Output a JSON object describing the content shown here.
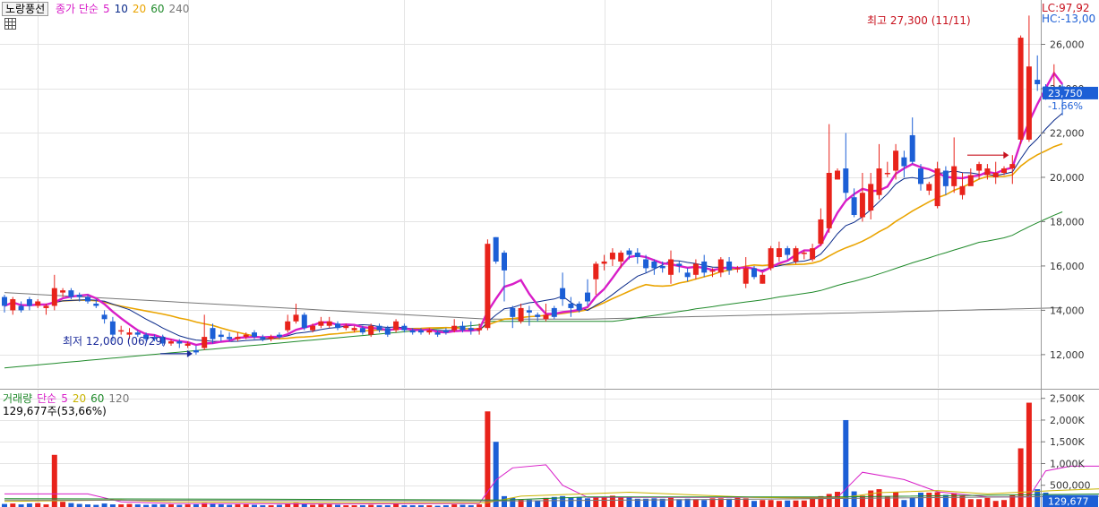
{
  "header": {
    "stock_name": "노랑풍선",
    "price_legend": [
      "종가 단순",
      "5",
      "10",
      "20",
      "60",
      "240"
    ],
    "volume_legend": [
      "거래량",
      "단순",
      "5",
      "20",
      "60",
      "120"
    ],
    "volume_info": "129,677주(53,66%)",
    "lc": "LC:97,92",
    "hc": "HC:-13,00"
  },
  "annotations": {
    "high": "최고 27,300 (11/11)",
    "low": "최저 12,000 (06/29)"
  },
  "price_axis": {
    "ticks": [
      "12,000",
      "14,000",
      "16,000",
      "18,000",
      "20,000",
      "22,000",
      "24,000",
      "26,000"
    ],
    "current": "23,750",
    "change": "-1.66%"
  },
  "volume_axis": {
    "ticks": [
      "500,000",
      "1,000K",
      "1,500K",
      "2,000K",
      "2,500K"
    ],
    "current": "129,677",
    "pct": "53,66%"
  },
  "colors": {
    "up": "#e8231b",
    "down": "#1c5fd6",
    "ma5": "#d81ec8",
    "ma10": "#0a2a8a",
    "ma20": "#eaa400",
    "ma60": "#1f8a2a",
    "ma240": "#777777",
    "vma5": "#d81ec8",
    "vma20": "#c8b400",
    "vma60": "#1f8a2a",
    "vma120": "#777777"
  },
  "chart_data": {
    "type": "candlestick",
    "price_ylim": [
      10500,
      28000
    ],
    "volume_ylim": [
      0,
      2700000
    ],
    "candles": [
      [
        14600,
        14200,
        14700,
        13900
      ],
      [
        14000,
        14500,
        14600,
        13800
      ],
      [
        14200,
        14000,
        14400,
        13900
      ],
      [
        14500,
        14200,
        14600,
        14000
      ],
      [
        14200,
        14400,
        14500,
        14100
      ],
      [
        14100,
        14200,
        14300,
        13800
      ],
      [
        14200,
        15000,
        15600,
        14000
      ],
      [
        14800,
        14900,
        15000,
        14600
      ],
      [
        14900,
        14600,
        15000,
        14500
      ],
      [
        14700,
        14600,
        14800,
        14400
      ],
      [
        14600,
        14400,
        14700,
        14300
      ],
      [
        14300,
        14200,
        14500,
        14100
      ],
      [
        13800,
        13600,
        14000,
        13400
      ],
      [
        13500,
        12900,
        13700,
        12600
      ],
      [
        13100,
        13100,
        13300,
        12900
      ],
      [
        12900,
        13000,
        13200,
        12700
      ],
      [
        13000,
        12900,
        13100,
        12800
      ],
      [
        12900,
        12700,
        13000,
        12600
      ],
      [
        12800,
        12700,
        12900,
        12600
      ],
      [
        12800,
        12500,
        12900,
        12400
      ],
      [
        12500,
        12600,
        12700,
        12400
      ],
      [
        12600,
        12500,
        12700,
        12300
      ],
      [
        12400,
        12500,
        12600,
        12300
      ],
      [
        12200,
        12100,
        12400,
        12000
      ],
      [
        12300,
        12800,
        13800,
        12200
      ],
      [
        13200,
        12700,
        13400,
        12500
      ],
      [
        12900,
        12800,
        13100,
        12600
      ],
      [
        12800,
        12700,
        13000,
        12600
      ],
      [
        12700,
        12800,
        13000,
        12600
      ],
      [
        12800,
        12900,
        13000,
        12700
      ],
      [
        13000,
        12800,
        13100,
        12700
      ],
      [
        12800,
        12700,
        12900,
        12600
      ],
      [
        12700,
        12800,
        12900,
        12600
      ],
      [
        12900,
        12800,
        13000,
        12700
      ],
      [
        13100,
        13500,
        13800,
        13000
      ],
      [
        13500,
        13800,
        14300,
        13400
      ],
      [
        13800,
        13200,
        13900,
        13100
      ],
      [
        13100,
        13300,
        13400,
        13000
      ],
      [
        13300,
        13500,
        13700,
        13200
      ],
      [
        13300,
        13500,
        13700,
        13200
      ],
      [
        13400,
        13200,
        13500,
        13100
      ],
      [
        13200,
        13300,
        13400,
        13100
      ],
      [
        13100,
        13200,
        13300,
        13000
      ],
      [
        13200,
        13000,
        13300,
        12900
      ],
      [
        12900,
        13300,
        13400,
        12800
      ],
      [
        13300,
        13100,
        13400,
        13000
      ],
      [
        13200,
        12900,
        13300,
        12800
      ],
      [
        13100,
        13500,
        13600,
        13000
      ],
      [
        13300,
        13100,
        13400,
        13000
      ],
      [
        13100,
        13000,
        13200,
        12900
      ],
      [
        13100,
        13000,
        13200,
        12900
      ],
      [
        13000,
        13100,
        13200,
        12900
      ],
      [
        13000,
        12900,
        13100,
        12800
      ],
      [
        13100,
        13000,
        13200,
        12900
      ],
      [
        13100,
        13300,
        13600,
        13000
      ],
      [
        13300,
        13100,
        13500,
        13000
      ],
      [
        13200,
        13100,
        13500,
        12900
      ],
      [
        13100,
        13200,
        13400,
        12900
      ],
      [
        13200,
        17000,
        17200,
        13100
      ],
      [
        17300,
        16200,
        17300,
        16100
      ],
      [
        16600,
        15800,
        16700,
        14400
      ],
      [
        14100,
        13700,
        14200,
        13200
      ],
      [
        13500,
        14100,
        14300,
        13400
      ],
      [
        14000,
        13900,
        14200,
        13300
      ],
      [
        13800,
        13700,
        13900,
        13500
      ],
      [
        13600,
        13800,
        14300,
        13500
      ],
      [
        14100,
        13700,
        14200,
        13600
      ],
      [
        15000,
        14500,
        15700,
        14200
      ],
      [
        14300,
        14100,
        14600,
        13700
      ],
      [
        14300,
        14000,
        14400,
        13900
      ],
      [
        14800,
        14400,
        15400,
        14200
      ],
      [
        15400,
        16100,
        16200,
        14700
      ],
      [
        16100,
        16200,
        16500,
        15800
      ],
      [
        16300,
        16600,
        16800,
        16000
      ],
      [
        16200,
        16600,
        16700,
        15900
      ],
      [
        16700,
        16500,
        16800,
        16300
      ],
      [
        16600,
        16400,
        16800,
        16100
      ],
      [
        16300,
        15900,
        16500,
        15700
      ],
      [
        16200,
        15900,
        16300,
        15600
      ],
      [
        16000,
        15900,
        16200,
        15700
      ],
      [
        15600,
        16300,
        16700,
        15200
      ],
      [
        16100,
        16000,
        16200,
        15700
      ],
      [
        15700,
        15500,
        15900,
        15300
      ],
      [
        15600,
        16100,
        16300,
        15400
      ],
      [
        16200,
        15700,
        16500,
        15500
      ],
      [
        15800,
        15800,
        15900,
        15500
      ],
      [
        15700,
        16300,
        16400,
        15500
      ],
      [
        16200,
        15800,
        16400,
        15600
      ],
      [
        15900,
        15900,
        16000,
        15700
      ],
      [
        15200,
        15900,
        16400,
        15000
      ],
      [
        15900,
        15500,
        16000,
        15400
      ],
      [
        15200,
        15600,
        15700,
        15200
      ],
      [
        15900,
        16800,
        16900,
        15800
      ],
      [
        16400,
        16800,
        17100,
        16200
      ],
      [
        16800,
        16500,
        16900,
        16300
      ],
      [
        16200,
        16800,
        16900,
        16100
      ],
      [
        16600,
        16600,
        16700,
        16300
      ],
      [
        16300,
        16800,
        17000,
        16200
      ],
      [
        17000,
        18100,
        18600,
        16900
      ],
      [
        17700,
        20200,
        22400,
        17500
      ],
      [
        19900,
        20300,
        20400,
        19900
      ],
      [
        20400,
        19300,
        22000,
        19000
      ],
      [
        19100,
        18300,
        19500,
        18200
      ],
      [
        18200,
        19300,
        20200,
        18000
      ],
      [
        18500,
        19700,
        20200,
        18100
      ],
      [
        19200,
        20400,
        21500,
        19000
      ],
      [
        20200,
        20200,
        20700,
        20000
      ],
      [
        20300,
        21200,
        21500,
        19900
      ],
      [
        20900,
        20500,
        21200,
        20000
      ],
      [
        21900,
        20700,
        22700,
        20600
      ],
      [
        20400,
        19700,
        20600,
        19400
      ],
      [
        19400,
        19700,
        19800,
        19200
      ],
      [
        18700,
        20400,
        20700,
        18600
      ],
      [
        20300,
        19600,
        20500,
        19200
      ],
      [
        19600,
        20500,
        21800,
        19300
      ],
      [
        19200,
        19600,
        20200,
        19000
      ],
      [
        19600,
        20100,
        20400,
        19700
      ],
      [
        20300,
        20600,
        20700,
        19900
      ],
      [
        20100,
        20400,
        20600,
        19900
      ],
      [
        20000,
        20200,
        20700,
        19700
      ],
      [
        20200,
        20400,
        20500,
        20100
      ],
      [
        20400,
        20600,
        21000,
        19700
      ],
      [
        21700,
        26300,
        26400,
        21500
      ],
      [
        21700,
        25000,
        27300,
        21600
      ],
      [
        24400,
        24200,
        25500,
        23900
      ],
      [
        24100,
        24000,
        24200,
        23500
      ],
      [
        24000,
        24000,
        25100,
        23500
      ],
      [
        24100,
        23800,
        24200,
        22800
      ]
    ],
    "volume": [
      70000,
      80000,
      60000,
      80000,
      90000,
      60000,
      1200000,
      120000,
      90000,
      70000,
      60000,
      50000,
      80000,
      60000,
      60000,
      70000,
      60000,
      50000,
      60000,
      60000,
      60000,
      50000,
      60000,
      60000,
      90000,
      70000,
      60000,
      50000,
      60000,
      60000,
      50000,
      40000,
      40000,
      50000,
      80000,
      90000,
      70000,
      50000,
      60000,
      60000,
      50000,
      40000,
      40000,
      40000,
      50000,
      40000,
      40000,
      80000,
      40000,
      40000,
      40000,
      40000,
      30000,
      40000,
      60000,
      50000,
      40000,
      60000,
      2200000,
      1500000,
      250000,
      210000,
      170000,
      170000,
      150000,
      210000,
      230000,
      250000,
      220000,
      230000,
      200000,
      230000,
      220000,
      260000,
      230000,
      230000,
      190000,
      190000,
      200000,
      190000,
      210000,
      180000,
      190000,
      180000,
      160000,
      200000,
      200000,
      190000,
      210000,
      200000,
      140000,
      160000,
      160000,
      140000,
      150000,
      150000,
      150000,
      230000,
      250000,
      300000,
      350000,
      2000000,
      360000,
      260000,
      380000,
      410000,
      250000,
      350000,
      160000,
      220000,
      330000,
      330000,
      340000,
      280000,
      320000,
      260000,
      180000,
      180000,
      210000,
      140000,
      160000,
      270000,
      1350000,
      2400000,
      410000,
      330000,
      230000,
      130000
    ],
    "volume_ma": [
      {
        "name": "5",
        "values": [
          [
            0,
            300000
          ],
          [
            5,
            300000
          ],
          [
            10,
            300000
          ],
          [
            14,
            120000
          ],
          [
            20,
            80000
          ],
          [
            40,
            70000
          ],
          [
            57,
            80000
          ],
          [
            59,
            620000
          ],
          [
            61,
            900000
          ],
          [
            65,
            970000
          ],
          [
            67,
            500000
          ],
          [
            70,
            220000
          ],
          [
            100,
            220000
          ],
          [
            103,
            800000
          ],
          [
            108,
            630000
          ],
          [
            112,
            350000
          ],
          [
            118,
            230000
          ],
          [
            123,
            230000
          ],
          [
            125,
            830000
          ],
          [
            128,
            940000
          ],
          [
            132,
            940000
          ]
        ]
      },
      {
        "name": "20",
        "values": [
          [
            0,
            130000
          ],
          [
            14,
            160000
          ],
          [
            20,
            120000
          ],
          [
            40,
            100000
          ],
          [
            58,
            100000
          ],
          [
            62,
            250000
          ],
          [
            75,
            340000
          ],
          [
            90,
            220000
          ],
          [
            100,
            200000
          ],
          [
            105,
            330000
          ],
          [
            112,
            380000
          ],
          [
            118,
            300000
          ],
          [
            126,
            380000
          ],
          [
            132,
            420000
          ]
        ]
      },
      {
        "name": "60",
        "values": [
          [
            0,
            190000
          ],
          [
            30,
            180000
          ],
          [
            60,
            160000
          ],
          [
            70,
            230000
          ],
          [
            100,
            230000
          ],
          [
            132,
            300000
          ]
        ]
      },
      {
        "name": "120",
        "values": [
          [
            0,
            160000
          ],
          [
            60,
            140000
          ],
          [
            90,
            180000
          ],
          [
            132,
            250000
          ]
        ]
      }
    ]
  }
}
